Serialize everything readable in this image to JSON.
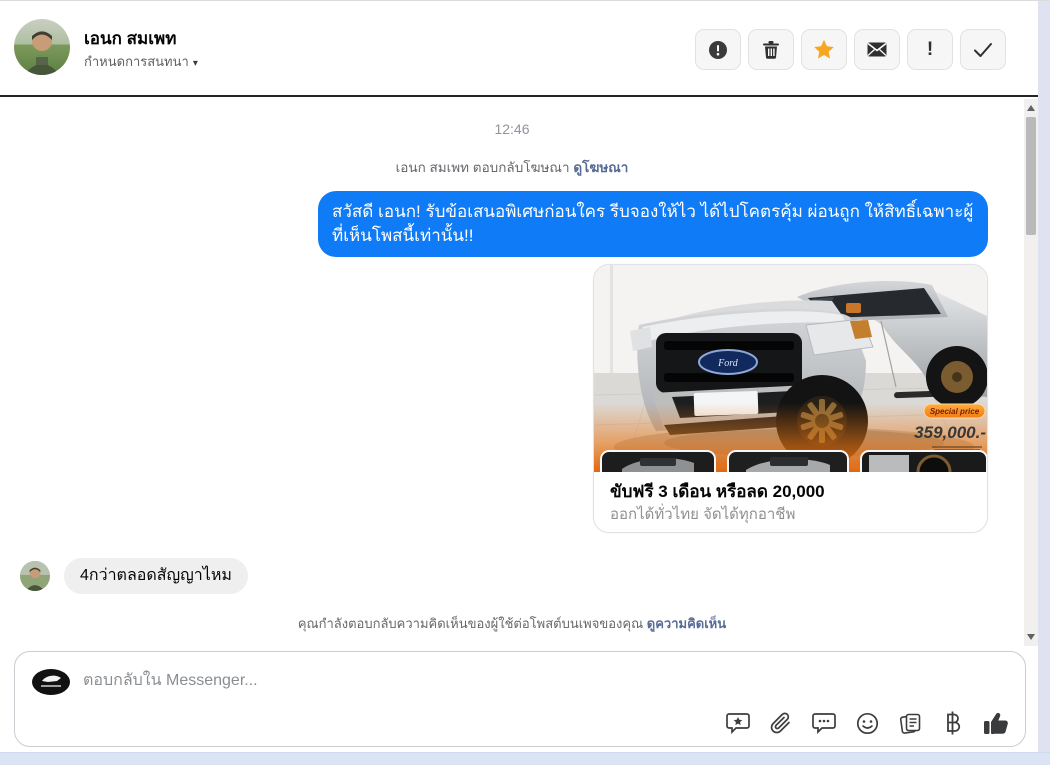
{
  "header": {
    "name": "เอนก สมเพท",
    "subtitle": "กำหนดการสนทนา",
    "caret": "▾",
    "action_icons": [
      "alert-circle-icon",
      "trash-icon",
      "star-icon",
      "mail-icon",
      "exclamation-icon",
      "check-icon"
    ],
    "exclamation_glyph": "!"
  },
  "conversation": {
    "timestamp": "12:46",
    "meta_text": "เอนก สมเพท ตอบกลับโฆษณา",
    "meta_link": "ดูโฆษณา",
    "outgoing_message": "สวัสดี เอนก! รับข้อเสนอพิเศษก่อนใคร รีบจองให้ไว ได้ไปโคตรคุ้ม ผ่อนถูก ให้สิทธิ์เฉพาะผู้ที่เห็นโพสนี้เท่านั้น!!",
    "ad_card": {
      "badge": "Special price",
      "price": "359,000.-",
      "brand": "Ford",
      "title": "ขับฟรี 3 เดือน หรือลด 20,000",
      "subtitle": "ออกได้ทั่วไทย จัดได้ทุกอาชีพ"
    },
    "incoming_message": "4กว่าตลอดสัญญาไหม",
    "status_text": "คุณกำลังตอบกลับความคิดเห็นของผู้ใช้ต่อโพสต์บนเพจของคุณ",
    "status_link": "ดูความคิดเห็น"
  },
  "composer": {
    "placeholder": "ตอบกลับใน Messenger...",
    "icons": [
      "sticker-icon",
      "paperclip-icon",
      "comment-dots-icon",
      "emoji-icon",
      "saved-replies-icon",
      "baht-payment-icon",
      "like-thumb-icon"
    ]
  },
  "colors": {
    "outgoing_bubble": "#0f7bf6",
    "star_accent": "#f5a623",
    "ad_orange": "#e8751a",
    "link": "#576b95"
  }
}
